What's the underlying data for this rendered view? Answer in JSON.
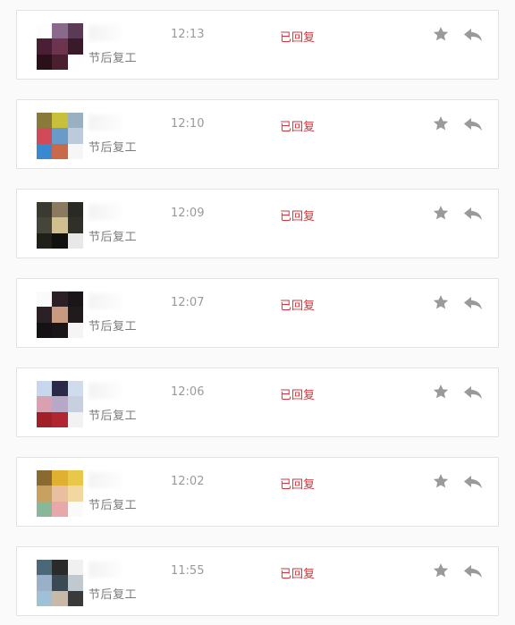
{
  "messages": [
    {
      "subject": "节后复工",
      "time": "12:13",
      "status": "已回复",
      "avatar_colors": [
        "#fdfdfd",
        "#8a6a8a",
        "#5a3a55",
        "#4a1f35",
        "#6b3550",
        "#3a1a2a",
        "#2a1018",
        "#4a2030",
        "#fefefe"
      ]
    },
    {
      "subject": "节后复工",
      "time": "12:10",
      "status": "已回复",
      "avatar_colors": [
        "#8a7a3a",
        "#c8c03a",
        "#9ab0c0",
        "#d04a5a",
        "#6a9ac8",
        "#bccadb",
        "#3a88d0",
        "#c86a4a",
        "#f6f6f6"
      ]
    },
    {
      "subject": "节后复工",
      "time": "12:09",
      "status": "已回复",
      "avatar_colors": [
        "#3a3a30",
        "#8a7a60",
        "#2a2a25",
        "#45453a",
        "#d0c090",
        "#303028",
        "#20201a",
        "#111111",
        "#e8e8e8"
      ]
    },
    {
      "subject": "节后复工",
      "time": "12:07",
      "status": "已回复",
      "avatar_colors": [
        "#fafafa",
        "#2a2025",
        "#1a1518",
        "#2a2025",
        "#c89a80",
        "#201a1d",
        "#151215",
        "#1a1518",
        "#f5f5f5"
      ]
    },
    {
      "subject": "节后复工",
      "time": "12:06",
      "status": "已回复",
      "avatar_colors": [
        "#c8d8ec",
        "#2a2a48",
        "#d0dcec",
        "#d8a0b0",
        "#b8a8c8",
        "#c8d0e0",
        "#a02028",
        "#b02530",
        "#f2f2f2"
      ]
    },
    {
      "subject": "节后复工",
      "time": "12:02",
      "status": "已回复",
      "avatar_colors": [
        "#8a6a30",
        "#e0b030",
        "#e8c848",
        "#c8a060",
        "#e8c0a0",
        "#f0d8a0",
        "#88b898",
        "#e8a8a8",
        "#fafafa"
      ]
    },
    {
      "subject": "节后复工",
      "time": "11:55",
      "status": "已回复",
      "avatar_colors": [
        "#4a6878",
        "#2a2a2a",
        "#f0f0f0",
        "#9ab0c8",
        "#3a4a55",
        "#c0c8d0",
        "#a0c0d8",
        "#c8b8a8",
        "#3a3a3a"
      ]
    }
  ],
  "colors": {
    "status": "#d0363b",
    "icon": "#9a9a9a",
    "time": "#9a9a9a",
    "subject": "#7a7a7a"
  },
  "icons": {
    "star": "star-icon",
    "reply": "reply-icon"
  }
}
